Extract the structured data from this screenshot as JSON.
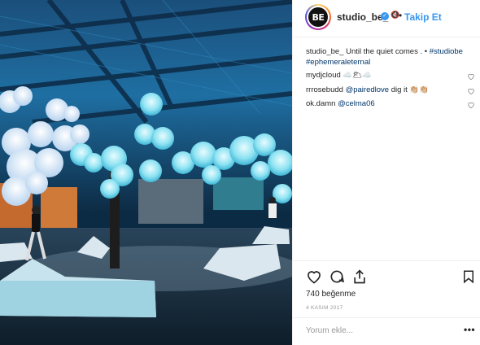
{
  "post": {
    "username": "studio_be_",
    "avatar_text": "BE",
    "follow_label": "Takip Et",
    "caption_user": "studio_be_",
    "caption_text": "Until the quiet comes .",
    "caption_sep": "•",
    "hashtags": [
      "#studiobe",
      "#ephemeraleternal"
    ],
    "comments": [
      {
        "user": "mydjcloud",
        "text": "☁️🌥☁️",
        "mention": ""
      },
      {
        "user": "rrrosebudd",
        "mention": "@pairedlove",
        "text": "dig it 👏🏼👏🏼"
      },
      {
        "user": "ok.damn",
        "mention": "@celma06",
        "text": ""
      }
    ],
    "likes": "740 beğenme",
    "date": "4 KASIM 2017",
    "comment_placeholder": "Yorum ekle...",
    "more": "•••"
  },
  "icons": {
    "like": "heart-icon",
    "comment": "comment-icon",
    "share": "share-icon",
    "save": "bookmark-icon",
    "verified": "verified-badge-icon",
    "mute": "mute-icon"
  },
  "colors": {
    "link": "#3897f0",
    "hashtag": "#003569",
    "clouds": "#8fe3f2"
  }
}
